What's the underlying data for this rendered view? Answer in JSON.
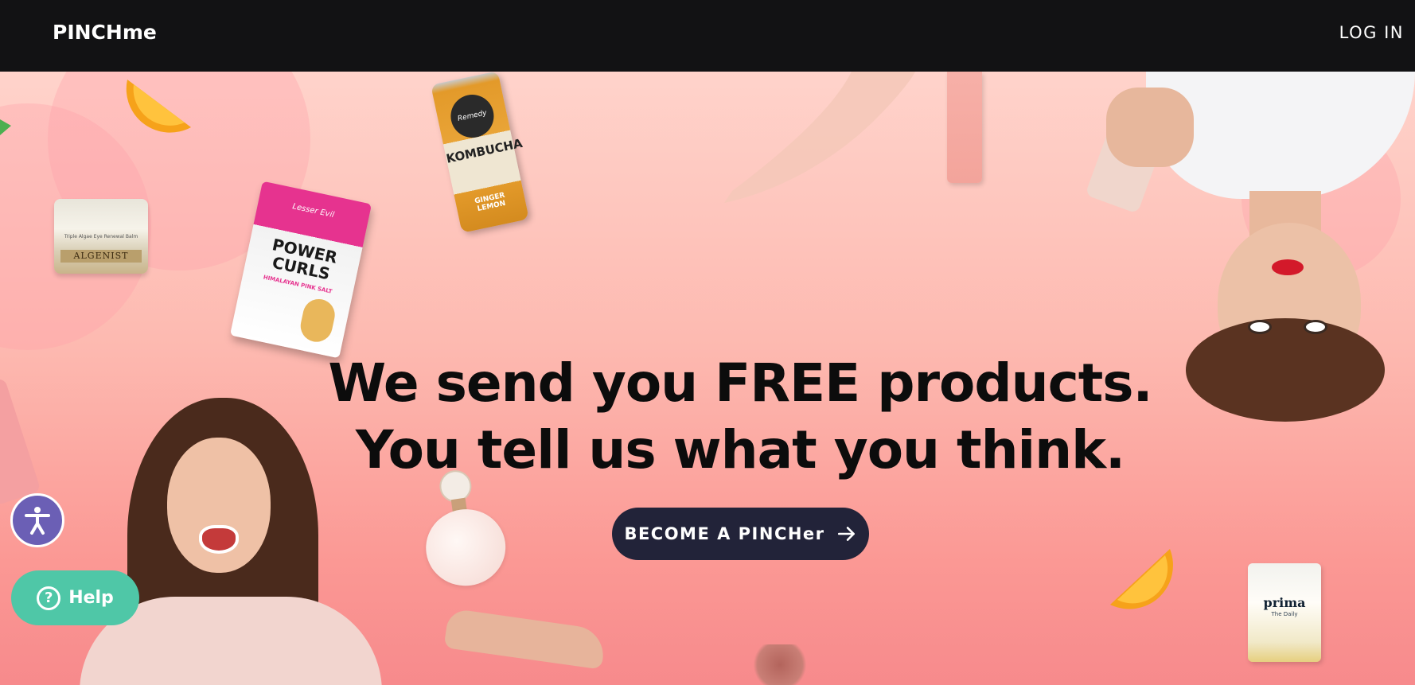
{
  "header": {
    "logo": "PINCHme",
    "login_label": "LOG IN"
  },
  "hero": {
    "headline_line1": "We send you FREE products.",
    "headline_line2": "You tell us what you think.",
    "cta_label": "BECOME A PINCHer",
    "cta_icon": "arrow-right-icon"
  },
  "products": {
    "kombucha_brand": "Remedy",
    "kombucha_name": "KOMBUCHA",
    "kombucha_flavor": "GINGER LEMON",
    "snack_brand": "Lesser Evil",
    "snack_name": "POWER CURLS",
    "snack_flavor": "HIMALAYAN PINK SALT",
    "cream_brand": "ALGENIST",
    "cream_desc": "Triple Algae Eye Renewal Balm",
    "jar_brand": "prima",
    "jar_desc": "The Daily"
  },
  "widgets": {
    "help_label": "Help",
    "accessibility_icon": "accessibility-icon"
  },
  "colors": {
    "topbar": "#121214",
    "cta": "#222339",
    "help": "#4fc7a7",
    "accessibility": "#6b5fb5"
  }
}
